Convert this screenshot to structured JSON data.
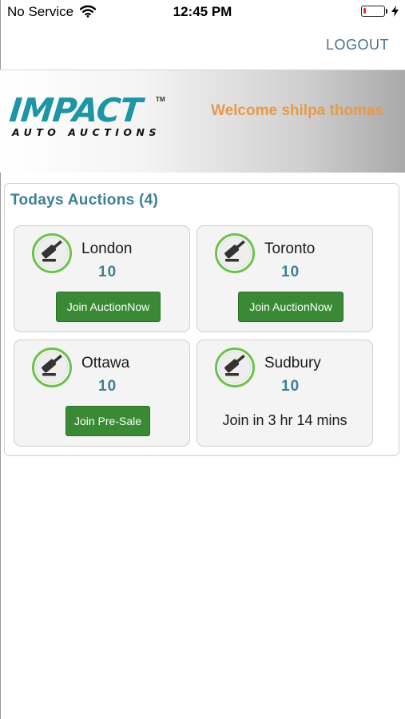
{
  "status_bar": {
    "carrier": "No Service",
    "time": "12:45 PM",
    "battery_color": "#e5332a"
  },
  "nav": {
    "logout_label": "LOGOUT"
  },
  "banner": {
    "logo_main": "IMPACT",
    "logo_tm": "TM",
    "logo_sub": "AUTO AUCTIONS",
    "welcome": "Welcome shilpa thomas"
  },
  "auctions": {
    "title": "Todays Auctions (4)",
    "items": [
      {
        "city": "London",
        "count": "10",
        "action": "Join AuctionNow"
      },
      {
        "city": "Toronto",
        "count": "10",
        "action": "Join AuctionNow"
      },
      {
        "city": "Ottawa",
        "count": "10",
        "action": "Join Pre-Sale"
      },
      {
        "city": "Sudbury",
        "count": "10",
        "status": "Join in 3 hr 14 mins"
      }
    ]
  },
  "colors": {
    "accent": "#3d7f93",
    "button": "#3a8a35",
    "welcome": "#e69a4a",
    "logo": "#1c95a5"
  },
  "icons": {
    "auction": "gavel-icon",
    "wifi": "wifi-icon",
    "charging": "bolt-icon"
  }
}
